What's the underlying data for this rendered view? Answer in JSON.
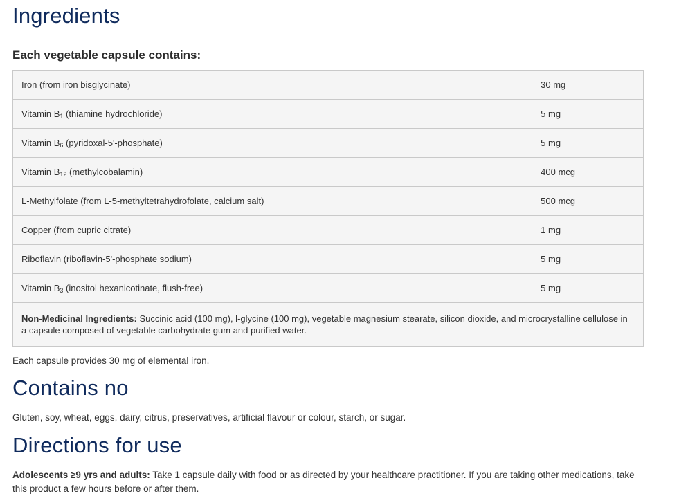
{
  "headings": {
    "ingredients": "Ingredients",
    "contains_no": "Contains no",
    "directions": "Directions for use"
  },
  "ingredients": {
    "subheading": "Each vegetable capsule contains:",
    "rows": [
      {
        "name": "Iron (from iron bisglycinate)",
        "amount": "30 mg"
      },
      {
        "name_pre": "Vitamin B",
        "name_sub": "1",
        "name_post": " (thiamine hydrochloride)",
        "amount": "5 mg"
      },
      {
        "name_pre": "Vitamin B",
        "name_sub": "6",
        "name_post": " (pyridoxal-5'-phosphate)",
        "amount": "5 mg"
      },
      {
        "name_pre": "Vitamin B",
        "name_sub": "12",
        "name_post": " (methylcobalamin)",
        "amount": "400 mcg"
      },
      {
        "name": "L-Methylfolate (from L-5-methyltetrahydrofolate, calcium salt)",
        "amount": "500 mcg"
      },
      {
        "name": "Copper (from cupric citrate)",
        "amount": "1 mg"
      },
      {
        "name": "Riboflavin (riboflavin-5'-phosphate sodium)",
        "amount": "5 mg"
      },
      {
        "name_pre": "Vitamin B",
        "name_sub": "3",
        "name_post": " (inositol hexanicotinate, flush-free)",
        "amount": "5 mg"
      }
    ],
    "non_medicinal_label": "Non-Medicinal Ingredients:",
    "non_medicinal_text": " Succinic acid (100 mg), l-glycine (100 mg), vegetable magnesium stearate, silicon dioxide, and microcrystalline cellulose in a capsule composed of vegetable carbohydrate gum and purified water."
  },
  "elemental_iron_note": "Each capsule provides 30 mg of elemental iron.",
  "contains_no_text": "Gluten, soy, wheat, eggs, dairy, citrus, preservatives, artificial flavour or colour, starch, or sugar.",
  "directions": {
    "label": "Adolescents ≥9 yrs and adults:",
    "text": " Take 1 capsule daily with food or as directed by your healthcare practitioner. If you are taking other medications, take this product a few hours before or after them."
  },
  "colors": {
    "heading": "#0f2a5c",
    "body_text": "#333333",
    "table_border": "#c9c9c9",
    "table_bg": "#f5f5f5"
  }
}
